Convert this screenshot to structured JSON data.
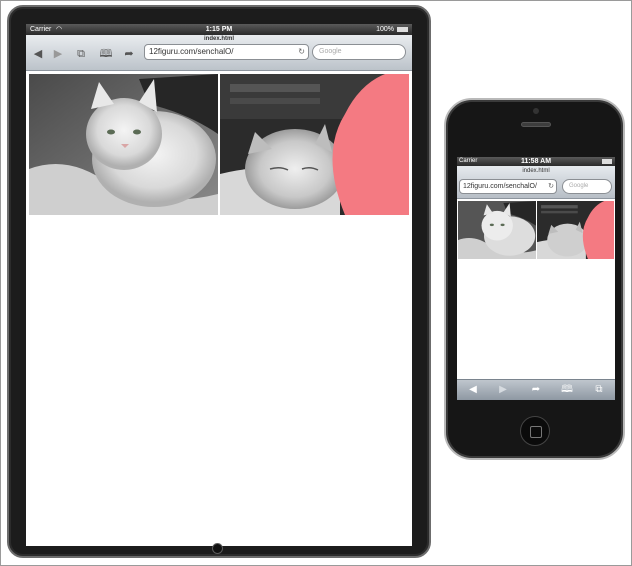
{
  "ipad": {
    "status": {
      "carrier": "Carrier",
      "time": "1:15 PM",
      "battery": "100%"
    },
    "browser": {
      "page_title": "index.html",
      "url": "12figuru.com/senchalO/",
      "search_placeholder": "Google"
    }
  },
  "iphone": {
    "status": {
      "carrier": "Carrier",
      "time": "11:58 AM"
    },
    "browser": {
      "page_title": "index.html",
      "url": "12figuru.com/senchalO/",
      "search_placeholder": "Google"
    }
  },
  "icons": {
    "wifi": "wifi-icon",
    "battery": "battery-icon",
    "back": "back-arrow-icon",
    "forward": "forward-arrow-icon",
    "tabs": "tabs-icon",
    "bookmarks": "bookmarks-icon",
    "share": "share-icon",
    "reload": "reload-icon",
    "pages": "pages-icon"
  },
  "colors": {
    "device_frame": "#1c1c1c",
    "toolbar_top": "#e9ecef",
    "toolbar_bottom": "#bcc3ca",
    "pink_accent": "#f47a82"
  }
}
